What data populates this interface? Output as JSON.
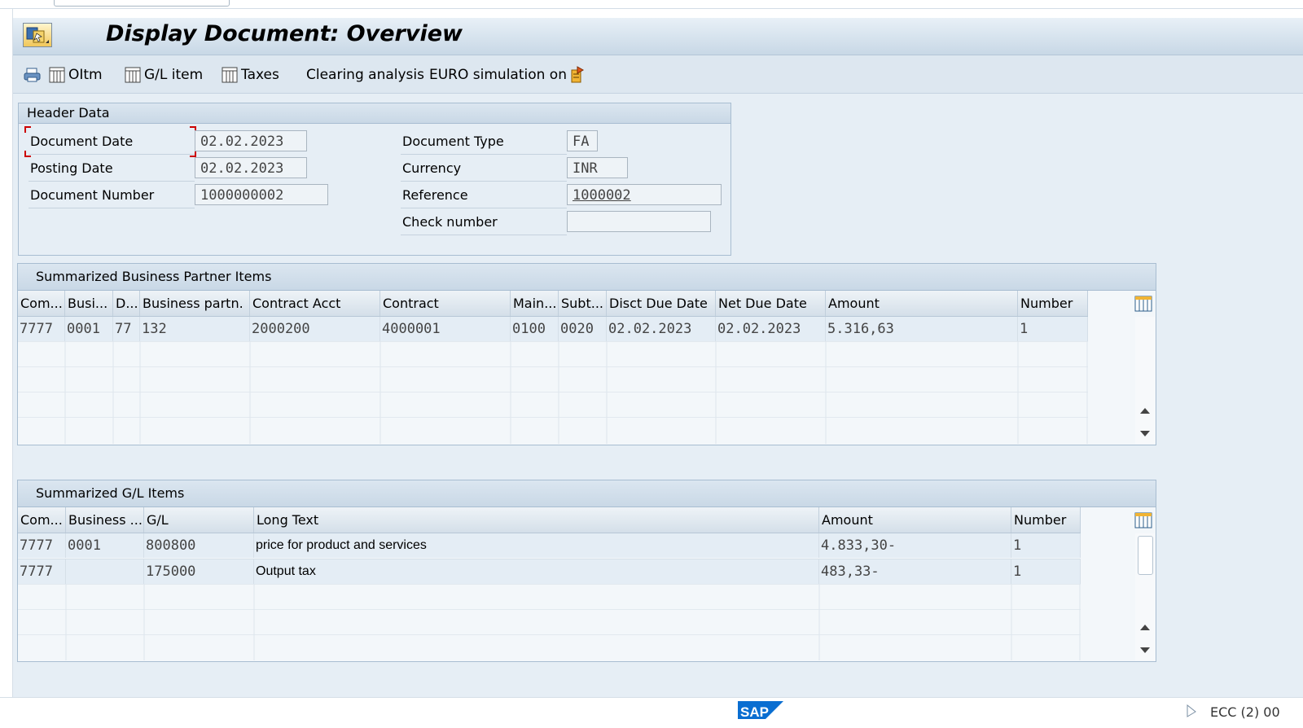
{
  "title": "Display Document: Overview",
  "toolbar": {
    "oitm": "OItm",
    "gl_item": "G/L item",
    "taxes": "Taxes",
    "clearing_analysis": "Clearing analysis",
    "euro_simulation": "EURO simulation on"
  },
  "header_data": {
    "title": "Header Data",
    "document_date": {
      "label": "Document Date",
      "value": "02.02.2023"
    },
    "posting_date": {
      "label": "Posting Date",
      "value": "02.02.2023"
    },
    "document_number": {
      "label": "Document Number",
      "value": "1000000002"
    },
    "document_type": {
      "label": "Document Type",
      "value": "FA"
    },
    "currency": {
      "label": "Currency",
      "value": "INR"
    },
    "reference": {
      "label": "Reference",
      "value": "1000002"
    },
    "check_number": {
      "label": "Check number",
      "value": ""
    }
  },
  "bp_items": {
    "title": "Summarized Business Partner Items",
    "columns": [
      "Com...",
      "Busi...",
      "D...",
      "Business partn.",
      "Contract Acct",
      "Contract",
      "Main...",
      "Subt...",
      "Disct Due Date",
      "Net Due Date",
      "Amount",
      "Number"
    ],
    "rows": [
      [
        "7777",
        "0001",
        "77",
        "132",
        "2000200",
        "4000001",
        "0100",
        "0020",
        "02.02.2023",
        "02.02.2023",
        "5.316,63",
        "1"
      ]
    ]
  },
  "gl_items": {
    "title": "Summarized G/L Items",
    "columns": [
      "Com...",
      "Business ...",
      "G/L",
      "Long Text",
      "Amount",
      "Number"
    ],
    "rows": [
      [
        "7777",
        "0001",
        "800800",
        "price for product and services",
        "4.833,30-",
        "1"
      ],
      [
        "7777",
        "",
        "175000",
        "Output tax",
        "483,33-",
        "1"
      ]
    ]
  },
  "status_bar": {
    "logo": "SAP",
    "system": "ECC (2) 00"
  },
  "colors": {
    "background": "#e6eef5",
    "panel_header": "#c9d8e6",
    "sap_blue": "#0a6ed1"
  },
  "icons": [
    "transaction-icon",
    "print-icon",
    "grid-icon",
    "euro-simulation-icon",
    "column-config-icon",
    "scroll-up-icon",
    "scroll-down-icon",
    "sap-logo"
  ]
}
